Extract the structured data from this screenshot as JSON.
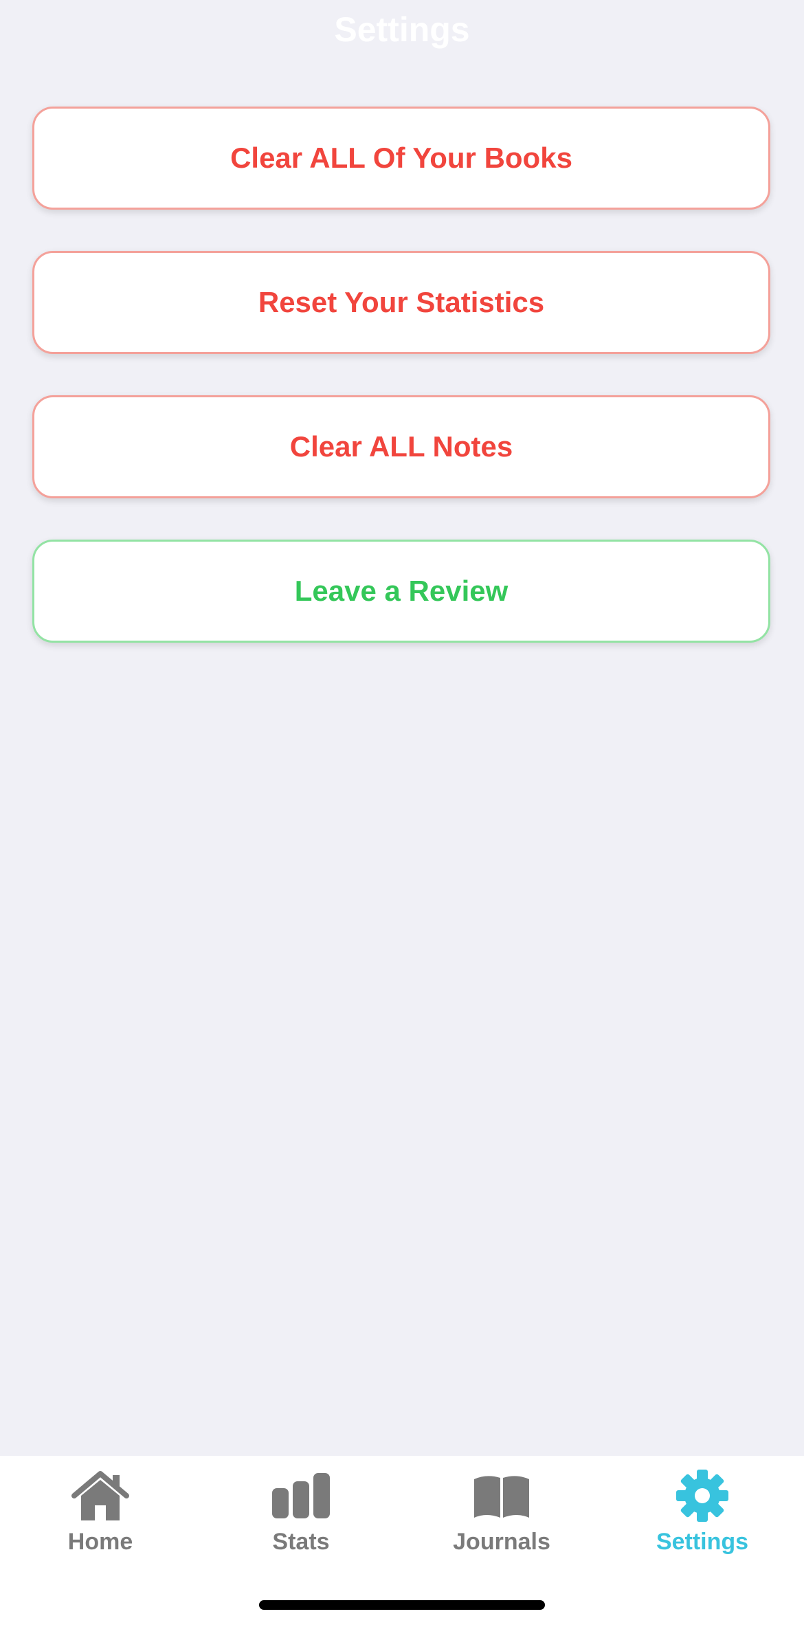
{
  "header": {
    "title": "Settings"
  },
  "actions": [
    {
      "label": "Clear ALL Of Your Books",
      "variant": "danger"
    },
    {
      "label": "Reset Your Statistics",
      "variant": "danger"
    },
    {
      "label": "Clear ALL Notes",
      "variant": "danger"
    },
    {
      "label": "Leave a Review",
      "variant": "success"
    }
  ],
  "tabbar": {
    "tabs": [
      {
        "label": "Home",
        "icon": "home-icon",
        "active": false
      },
      {
        "label": "Stats",
        "icon": "bar-chart-icon",
        "active": false
      },
      {
        "label": "Journals",
        "icon": "book-icon",
        "active": false
      },
      {
        "label": "Settings",
        "icon": "gear-icon",
        "active": true
      }
    ]
  },
  "colors": {
    "background": "#f0f0f6",
    "danger": "#f1453d",
    "success": "#34c759",
    "active_tab": "#38c3de",
    "inactive_tab": "#7a7a7a"
  }
}
